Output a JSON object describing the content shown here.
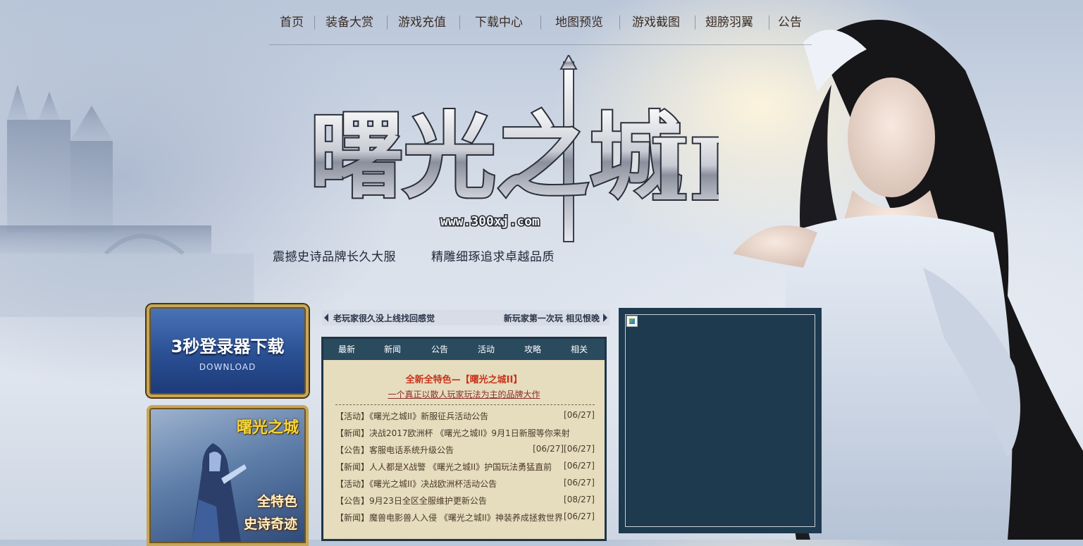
{
  "nav": {
    "items": [
      {
        "label": "首页"
      },
      {
        "label": "装备大赏"
      },
      {
        "label": "游戏充值"
      },
      {
        "label": "下载中心"
      },
      {
        "label": "地图预览"
      },
      {
        "label": "游戏截图"
      },
      {
        "label": "翅膀羽翼"
      },
      {
        "label": "公告"
      }
    ]
  },
  "logo": {
    "title": "曙光之城",
    "numeral": "II",
    "url": "www.300xj.com"
  },
  "slogans": [
    "震撼史诗品牌长久大服",
    "精雕细琢追求卓越品质"
  ],
  "download_banner": {
    "title": "3秒登录器下载",
    "subtitle": "DOWNLOAD"
  },
  "promo_banner": {
    "logo": "曙光之城",
    "line1": "全特色",
    "line2": "史诗奇迹"
  },
  "scroll": {
    "left_text": "老玩家很久没上线找回感觉",
    "right_text": "新玩家第一次玩 相见恨晚"
  },
  "news": {
    "tabs": [
      "最新",
      "新闻",
      "公告",
      "活动",
      "攻略",
      "相关"
    ],
    "headline": "全新全特色—【曙光之城II】",
    "subline": "一个真正以散人玩家玩法为主的品牌大作",
    "items": [
      {
        "text": "【活动】《曙光之城II》新服征兵活动公告",
        "date": "[06/27]"
      },
      {
        "text": "【新闻】决战2017欧洲杯 《曙光之城II》9月1日新服等你来射",
        "date": ""
      },
      {
        "text": "【公告】客服电话系统升级公告",
        "date": "[06/27][06/27]"
      },
      {
        "text": "【新闻】人人都是X战警 《曙光之城II》护国玩法勇猛直前",
        "date": "[06/27]"
      },
      {
        "text": "【活动】《曙光之城II》决战欧洲杯活动公告",
        "date": "[06/27]"
      },
      {
        "text": "【公告】9月23日全区全服维护更新公告",
        "date": "[08/27]"
      },
      {
        "text": "【新闻】魔兽电影兽人入侵 《曙光之城II》神装养成拯救世界",
        "date": "[06/27]"
      }
    ]
  },
  "colors": {
    "nav_text": "#3a2c24",
    "tab_bar": "#2a4a5e",
    "news_bg": "#e6dcbe",
    "headline": "#c8341b",
    "video_bg": "#1e3a4e",
    "banner_gold": "#c7a657"
  }
}
